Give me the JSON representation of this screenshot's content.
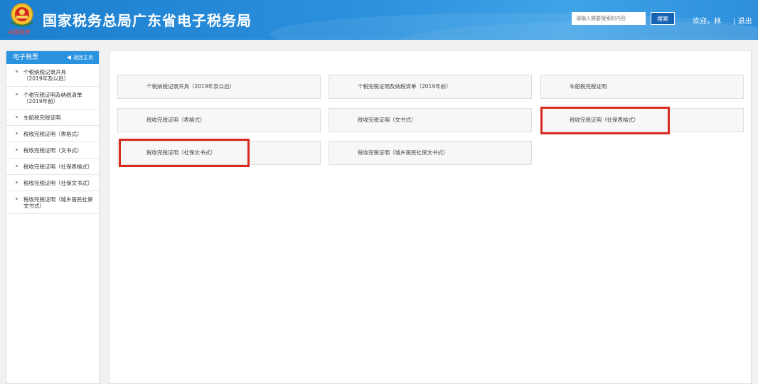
{
  "header": {
    "title": "国家税务总局广东省电子税务局",
    "emblem_caption": "中国税务",
    "search_placeholder": "请输入需要搜索的内容",
    "search_button": "搜索",
    "welcome": "欢迎，林",
    "logout": "| 退出"
  },
  "sidebar": {
    "title": "电子税票",
    "home_link": "返回主页",
    "items": [
      {
        "label": "个税纳税记录开具\n（2019年及以后）"
      },
      {
        "label": "个税完税证明及纳税清单\n（2019年前）"
      },
      {
        "label": "车船税完税证明"
      },
      {
        "label": "税收完税证明（表格式）"
      },
      {
        "label": "税收完税证明（文书式）"
      },
      {
        "label": "税收完税证明（社保表格式）"
      },
      {
        "label": "税收完税证明（社保文书式）"
      },
      {
        "label": "税收完税证明（城乡居民社保文书式）"
      }
    ]
  },
  "main": {
    "cards": [
      {
        "label": "个税纳税记录开具（2019年及以后）"
      },
      {
        "label": "个税完税证明及纳税清单（2019年前）"
      },
      {
        "label": "车船税完税证明"
      },
      {
        "label": "税收完税证明（表格式）"
      },
      {
        "label": "税收完税证明（文书式）"
      },
      {
        "label": "税收完税证明（社保表格式）"
      },
      {
        "label": "税收完税证明（社保文书式）"
      },
      {
        "label": "税收完税证明（城乡居民社保文书式）"
      }
    ]
  },
  "colors": {
    "header_blue": "#2a8fdc",
    "sidebar_head": "#2a93e0",
    "highlight_red": "#d92b1f"
  }
}
